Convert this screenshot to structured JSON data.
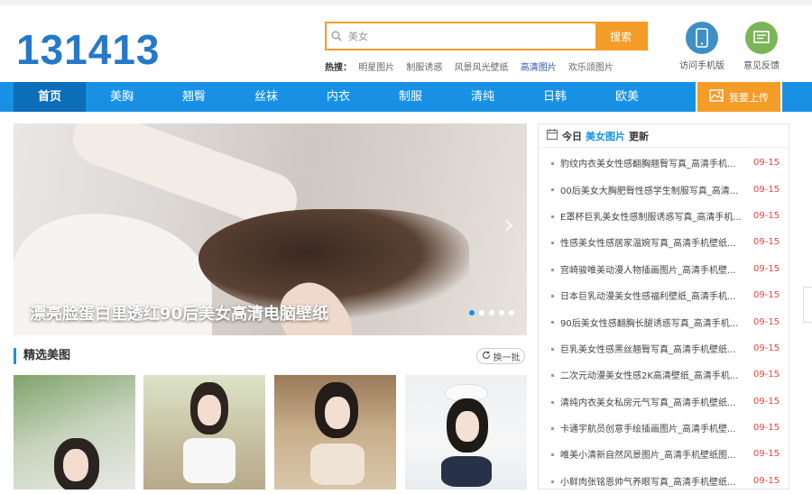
{
  "header": {
    "logo": "131413",
    "search": {
      "value": "美女",
      "button": "搜索"
    },
    "hot": {
      "label": "热搜：",
      "keywords": [
        "明星图片",
        "制服诱惑",
        "风景风光壁纸",
        "高清图片",
        "欢乐颂图片"
      ]
    },
    "mobile_label": "访问手机版",
    "feedback_label": "意见反馈"
  },
  "nav": {
    "items": [
      "首页",
      "美胸",
      "翘臀",
      "丝袜",
      "内衣",
      "制服",
      "清纯",
      "日韩",
      "欧美"
    ],
    "upload": "我要上传"
  },
  "banner": {
    "caption": "漂亮脸蛋白里透红90后美女高清电脑壁纸"
  },
  "featured": {
    "title": "精选美图",
    "refresh": "换一批"
  },
  "side": {
    "title_pre": "今日",
    "title_hl": "美女图片",
    "title_post": "更新",
    "items": [
      {
        "t": "豹纹内衣美女性感翻胸翘臀写真_高清手机...",
        "d": "09-15"
      },
      {
        "t": "00后美女大胸肥臀性感学生制服写真_高清...",
        "d": "09-15"
      },
      {
        "t": "E罩杯巨乳美女性感制服诱惑写真_高清手机...",
        "d": "09-15"
      },
      {
        "t": "性感美女性感居家温婉写真_高清手机壁纸...",
        "d": "09-15"
      },
      {
        "t": "宫崎骏唯美动漫人物插画图片_高清手机壁...",
        "d": "09-15"
      },
      {
        "t": "日本巨乳动漫美女性感福利壁纸_高清手机...",
        "d": "09-15"
      },
      {
        "t": "90后美女性感翻胸长腿诱惑写真_高清手机...",
        "d": "09-15"
      },
      {
        "t": "巨乳美女性感黑丝翘臀写真_高清手机壁纸...",
        "d": "09-15"
      },
      {
        "t": "二次元动漫美女性感2K高清壁纸_高清手机...",
        "d": "09-15"
      },
      {
        "t": "清纯内衣美女私房元气写真_高清手机壁纸...",
        "d": "09-15"
      },
      {
        "t": "卡通宇航员创意手绘插画图片_高清手机壁...",
        "d": "09-15"
      },
      {
        "t": "唯美小清新自然风景图片_高清手机壁纸图...",
        "d": "09-15"
      },
      {
        "t": "小鲜肉张铭恩帅气养眼写真_高清手机壁纸...",
        "d": "09-15"
      }
    ]
  }
}
